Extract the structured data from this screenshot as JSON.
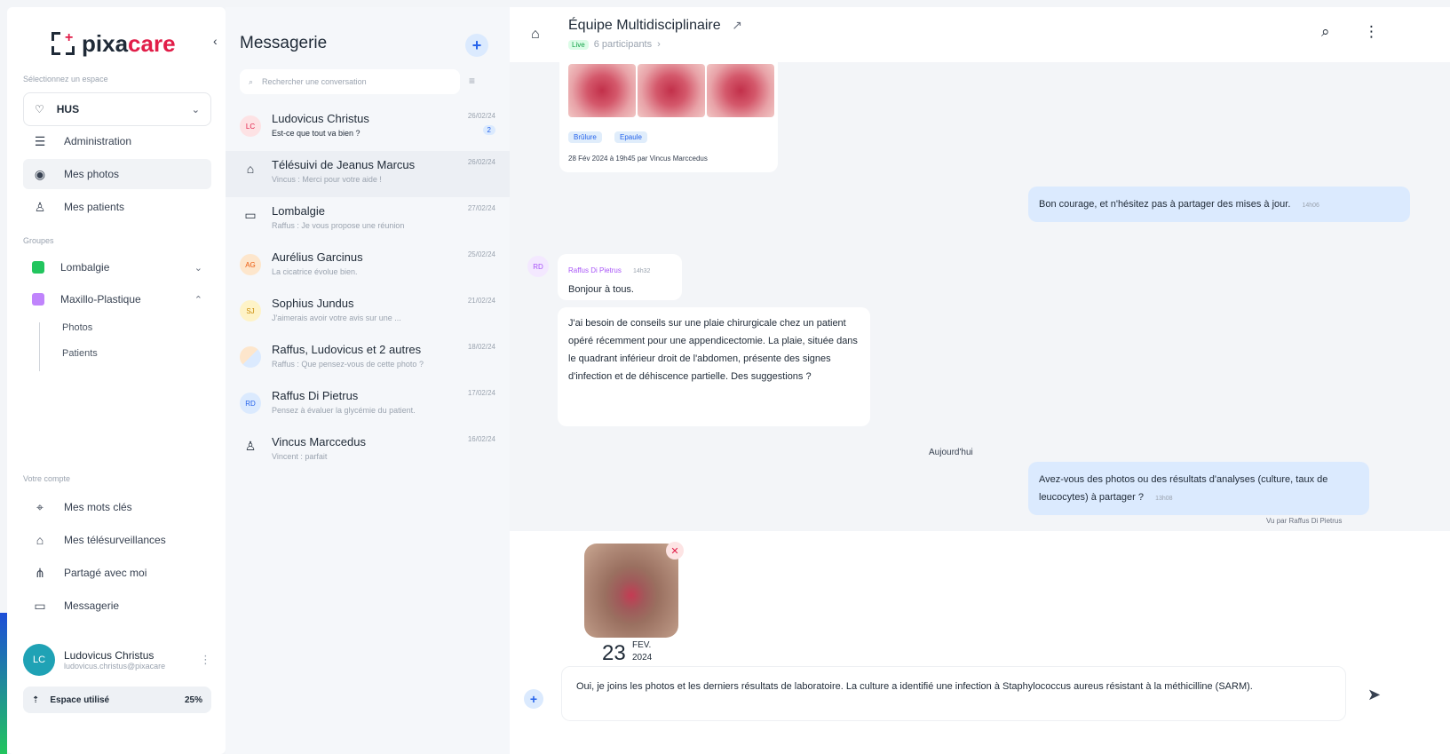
{
  "app": {
    "brand_part1": "pixa",
    "brand_part2": "care"
  },
  "sidebar": {
    "space_label": "Sélectionnez un espace",
    "space_value": "HUS",
    "nav": [
      {
        "label": "Administration",
        "icon": "sliders-icon"
      },
      {
        "label": "Mes photos",
        "icon": "camera-icon"
      },
      {
        "label": "Mes patients",
        "icon": "user-icon"
      }
    ],
    "groups_label": "Groupes",
    "groups": [
      {
        "label": "Lombalgie",
        "color": "#22c55e"
      },
      {
        "label": "Maxillo-Plastique",
        "color": "#c084fc"
      }
    ],
    "subitems": [
      "Photos",
      "Patients"
    ],
    "account_label": "Votre compte",
    "account_nav": [
      {
        "label": "Mes mots clés",
        "icon": "tag-icon"
      },
      {
        "label": "Mes télésurveillances",
        "icon": "home-icon"
      },
      {
        "label": "Partagé avec moi",
        "icon": "share-icon"
      },
      {
        "label": "Messagerie",
        "icon": "chat-icon"
      }
    ],
    "user": {
      "initials": "LC",
      "name": "Ludovicus Christus",
      "email": "ludovicus.christus@pixacare"
    },
    "storage": {
      "label": "Espace utilisé",
      "percent": "25%"
    }
  },
  "messagerie": {
    "title": "Messagerie",
    "search_placeholder": "Rechercher une conversation",
    "conversations": [
      {
        "name": "Ludovicus Christus",
        "preview": "Est-ce que tout va bien ?",
        "date": "26/02/24",
        "badge": "2",
        "initials": "LC"
      },
      {
        "name": "Télésuivi de Jeanus Marcus",
        "preview": "Vincus : Merci pour votre aide !",
        "date": "26/02/24"
      },
      {
        "name": "Lombalgie",
        "preview": "Raffus : Je vous propose une réunion",
        "date": "27/02/24"
      },
      {
        "name": "Aurélius Garcinus",
        "preview": "La cicatrice évolue bien.",
        "date": "25/02/24",
        "initials": "AG"
      },
      {
        "name": "Sophius Jundus",
        "preview": "J'aimerais avoir votre avis sur une ...",
        "date": "21/02/24",
        "initials": "SJ"
      },
      {
        "name": "Raffus, Ludovicus et 2 autres",
        "preview": "Raffus : Que pensez-vous de cette photo ?",
        "date": "18/02/24"
      },
      {
        "name": "Raffus Di Pietrus",
        "preview": "Pensez à évaluer la glycémie du patient.",
        "date": "17/02/24",
        "initials": "RD"
      },
      {
        "name": "Vincus Marccedus",
        "preview": "Vincent : parfait",
        "date": "16/02/24"
      }
    ]
  },
  "chat": {
    "title": "Équipe Multidisciplinaire",
    "live": "Live",
    "participants": "6 participants",
    "tags": [
      "Brûlure",
      "Epaule"
    ],
    "photo_date": "28 Fév 2024 à 19h45 par Vincus Marccedus",
    "msg_out_1": "Bon courage, et n'hésitez pas à partager des mises à jour.",
    "msg_out_1_time": "14h06",
    "sender": "Raffus Di Pietrus",
    "sender_time": "14h32",
    "sender_initials": "RD",
    "msg_in_1": "Bonjour à tous.",
    "msg_in_2": "J'ai besoin de conseils sur une plaie chirurgicale chez un patient opéré récemment pour une appendicectomie. La plaie, située dans le quadrant inférieur droit de l'abdomen, présente des signes d'infection et de déhiscence partielle. Des suggestions ?",
    "day": "Aujourd'hui",
    "msg_out_2": "Avez-vous des photos ou des résultats d'analyses (culture, taux de leucocytes) à partager ?",
    "msg_out_2_time": "13h08",
    "seen": "Vu par Raffus Di Pietrus",
    "attachment": {
      "day": "23",
      "month": "FEV.",
      "year": "2024"
    },
    "draft": "Oui, je joins les photos et les derniers résultats de laboratoire. La culture a identifié une infection à Staphylococcus aureus résistant à la méthicilline (SARM)."
  }
}
